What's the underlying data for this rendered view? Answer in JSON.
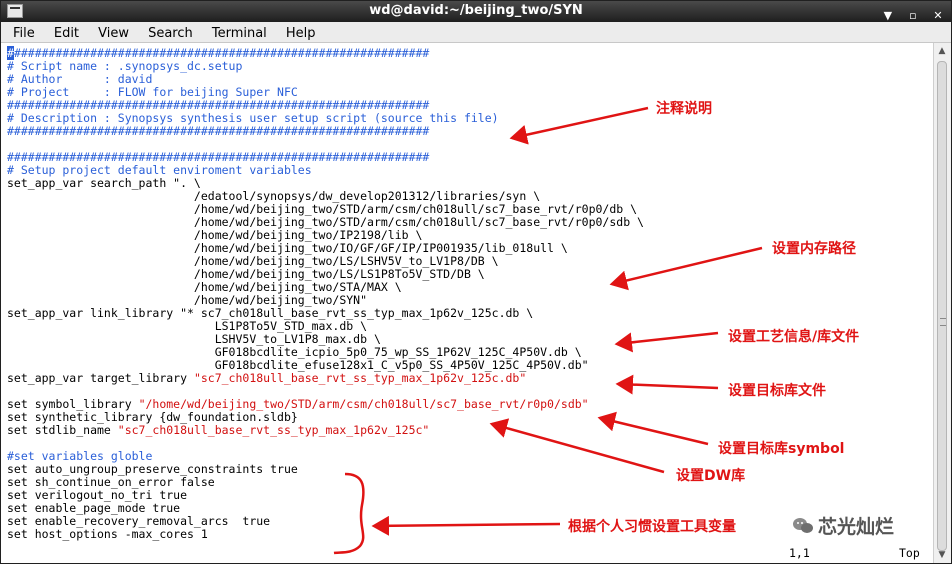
{
  "window": {
    "title": "wd@david:~/beijing_two/SYN",
    "min_glyph": "▼",
    "max_glyph": "▫",
    "close_glyph": "✕"
  },
  "menu": [
    "File",
    "Edit",
    "View",
    "Search",
    "Terminal",
    "Help"
  ],
  "terminal": {
    "lines": [
      [
        [
          "#",
          "cur"
        ],
        [
          "############################################################",
          "c"
        ]
      ],
      [
        [
          "# Script name : .synopsys_dc.setup",
          "c"
        ]
      ],
      [
        [
          "# Author      : david",
          "c"
        ]
      ],
      [
        [
          "# Project     : FLOW for beijing Super NFC",
          "c"
        ]
      ],
      [
        [
          "#############################################################",
          "c"
        ]
      ],
      [
        [
          "# Description : Synopsys synthesis user setup script (source this file)",
          "c"
        ]
      ],
      [
        [
          "#############################################################",
          "c"
        ]
      ],
      [
        [
          "",
          ""
        ]
      ],
      [
        [
          "#############################################################",
          "c"
        ]
      ],
      [
        [
          "# Setup project default enviroment variables",
          "c"
        ]
      ],
      [
        [
          "set_app_var search_path \". \\",
          ""
        ]
      ],
      [
        [
          "                           /edatool/synopsys/dw_develop201312/libraries/syn \\",
          ""
        ]
      ],
      [
        [
          "                           /home/wd/beijing_two/STD/arm/csm/ch018ull/sc7_base_rvt/r0p0/db \\",
          ""
        ]
      ],
      [
        [
          "                           /home/wd/beijing_two/STD/arm/csm/ch018ull/sc7_base_rvt/r0p0/sdb \\",
          ""
        ]
      ],
      [
        [
          "                           /home/wd/beijing_two/IP2198/lib \\",
          ""
        ]
      ],
      [
        [
          "                           /home/wd/beijing_two/IO/GF/GF/IP/IP001935/lib_018ull \\",
          ""
        ]
      ],
      [
        [
          "                           /home/wd/beijing_two/LS/LSHV5V_to_LV1P8/DB \\",
          ""
        ]
      ],
      [
        [
          "                           /home/wd/beijing_two/LS/LS1P8To5V_STD/DB \\",
          ""
        ]
      ],
      [
        [
          "                           /home/wd/beijing_two/STA/MAX \\",
          ""
        ]
      ],
      [
        [
          "                           /home/wd/beijing_two/SYN\"",
          ""
        ]
      ],
      [
        [
          "set_app_var link_library \"* sc7_ch018ull_base_rvt_ss_typ_max_1p62v_125c.db \\",
          ""
        ]
      ],
      [
        [
          "                              LS1P8To5V_STD_max.db \\",
          ""
        ]
      ],
      [
        [
          "                              LSHV5V_to_LV1P8_max.db \\",
          ""
        ]
      ],
      [
        [
          "                              GF018bcdlite_icpio_5p0_75_wp_SS_1P62V_125C_4P50V.db \\",
          ""
        ]
      ],
      [
        [
          "                              GF018bcdlite_efuse128x1_C_v5p0_SS_4P50V_125C_4P50V.db\"",
          ""
        ]
      ],
      [
        [
          "set_app_var target_library ",
          ""
        ],
        [
          "\"sc7_ch018ull_base_rvt_ss_typ_max_1p62v_125c.db\"",
          "s"
        ]
      ],
      [
        [
          "",
          ""
        ]
      ],
      [
        [
          "set symbol_library ",
          ""
        ],
        [
          "\"/home/wd/beijing_two/STD/arm/csm/ch018ull/sc7_base_rvt/r0p0/sdb\"",
          "s"
        ]
      ],
      [
        [
          "set synthetic_library {dw_foundation.sldb}",
          ""
        ]
      ],
      [
        [
          "set stdlib_name ",
          ""
        ],
        [
          "\"sc7_ch018ull_base_rvt_ss_typ_max_1p62v_125c\"",
          "s"
        ]
      ],
      [
        [
          "",
          ""
        ]
      ],
      [
        [
          "#set variables globle",
          "c"
        ]
      ],
      [
        [
          "set auto_ungroup_preserve_constraints true",
          ""
        ]
      ],
      [
        [
          "set sh_continue_on_error false",
          ""
        ]
      ],
      [
        [
          "set verilogout_no_tri true",
          ""
        ]
      ],
      [
        [
          "set enable_page_mode true",
          ""
        ]
      ],
      [
        [
          "set enable_recovery_removal_arcs  true",
          ""
        ]
      ],
      [
        [
          "set host_options -max_cores 1",
          ""
        ]
      ]
    ]
  },
  "status": {
    "position": "1,1",
    "scroll": "Top"
  },
  "annotations": {
    "comment_note": "注释说明",
    "search_path_note": "设置内存路径",
    "link_library_note": "设置工艺信息/库文件",
    "target_library_note": "设置目标库文件",
    "symbol_note": "设置目标库symbol",
    "dw_note": "设置DW库",
    "tool_vars_note": "根据个人习惯设置工具变量"
  },
  "watermark": "芯光灿烂",
  "colors": {
    "comment": "#2a5fd8",
    "string": "#d21010",
    "annotation": "#e01414"
  }
}
